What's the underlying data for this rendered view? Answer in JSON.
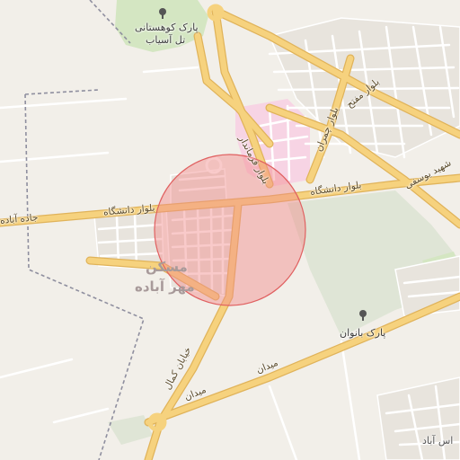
{
  "map": {
    "colors": {
      "background": "#f2efe9",
      "major_road": "#f6d27e",
      "road_casing": "#e0b35a",
      "minor_road": "#ffffff",
      "park": "#d4e6c2",
      "green_area": "#dfe5d6",
      "hospital_area": "#f7d4e4",
      "boundary": "#8f8f9f",
      "marker_fill": "#f28a8a",
      "marker_stroke": "#e06060"
    },
    "icons": [
      "tree-icon"
    ],
    "labels": {
      "park_top": "پارک کوهستانی",
      "park_top_2": "تل آسیاب",
      "blvd_moftah": "بلوار مفتح",
      "blvd_chamran": "بلوار چمران",
      "blvd_farmandari": "بلوار فرماندار",
      "blvd_daneshgah_right": "بلوار دانشگاه",
      "blvd_daneshgah_left": "بلوار دانشگاه",
      "shahid_yousefi": "شهید یوسفی",
      "jadeh_abadeh": "جاده آباده",
      "maskan": "مسکن",
      "mehr_abadeh": "مهر آباده",
      "park_banovan": "پارک بانوان",
      "meydan_1": "میدان",
      "meydan_2": "میدان",
      "ostad_kamal": "خیابان کمال",
      "bottom_right": "اس آباد"
    }
  }
}
